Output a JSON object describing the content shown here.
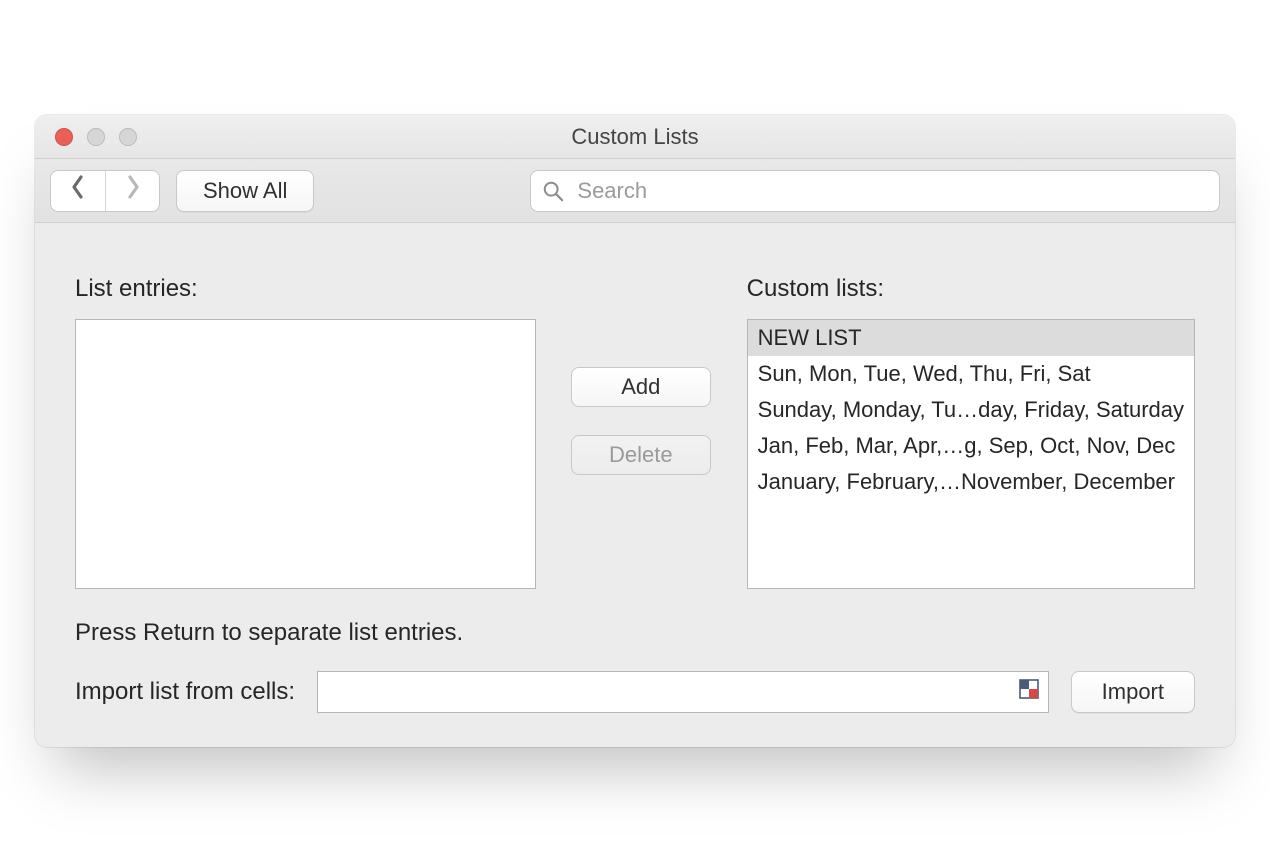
{
  "title": "Custom Lists",
  "toolbar": {
    "show_all_label": "Show All",
    "search_placeholder": "Search"
  },
  "labels": {
    "list_entries": "List entries:",
    "custom_lists": "Custom lists:",
    "hint": "Press Return to separate list entries.",
    "import_from_cells": "Import list from cells:"
  },
  "buttons": {
    "add": "Add",
    "delete": "Delete",
    "import": "Import"
  },
  "list_entries_value": "",
  "cell_reference_value": "",
  "custom_lists": [
    {
      "label": "NEW LIST",
      "selected": true
    },
    {
      "label": "Sun, Mon, Tue, Wed, Thu, Fri, Sat",
      "selected": false
    },
    {
      "label": "Sunday, Monday, Tu…day, Friday, Saturday",
      "selected": false
    },
    {
      "label": "Jan, Feb, Mar, Apr,…g, Sep, Oct, Nov, Dec",
      "selected": false
    },
    {
      "label": "January, February,…November, December",
      "selected": false
    }
  ]
}
